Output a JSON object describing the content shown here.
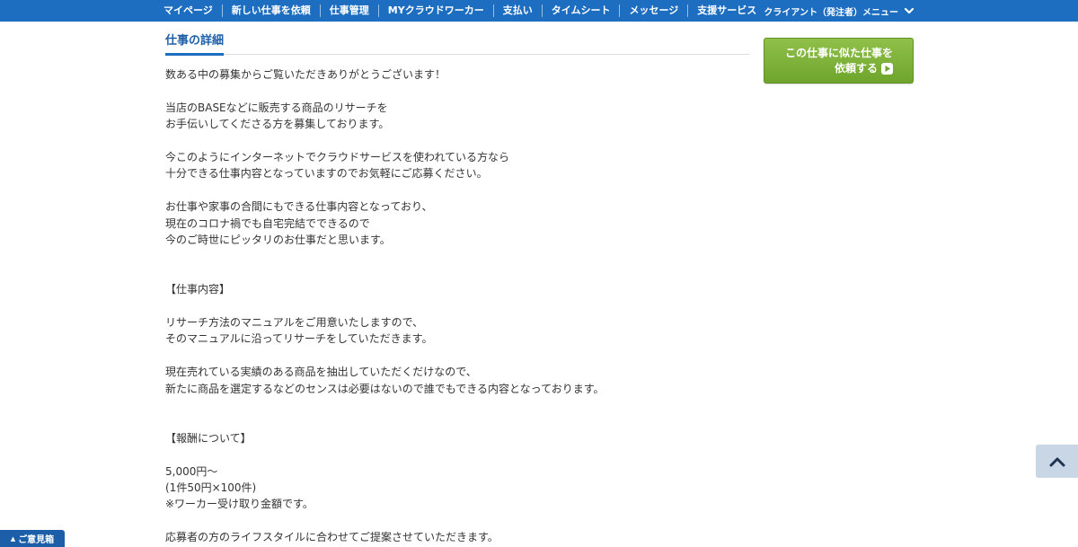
{
  "topnav": {
    "items": [
      {
        "label": "マイページ"
      },
      {
        "label": "新しい仕事を依頼"
      },
      {
        "label": "仕事管理"
      },
      {
        "label": "MYクラウドワーカー"
      },
      {
        "label": "支払い"
      },
      {
        "label": "タイムシート"
      },
      {
        "label": "メッセージ"
      },
      {
        "label": "支援サービス"
      }
    ],
    "client_menu_label": "クライアント（発注者）メニュー",
    "client_menu_icon": "chevron-down-icon"
  },
  "detail": {
    "title": "仕事の詳細",
    "lines": {
      "l1": "数ある中の募集からご覧いただきありがとうございます！",
      "l2": "当店のBASEなどに販売する商品のリサーチを",
      "l3": "お手伝いしてくださる方を募集しております。",
      "l4": "今このようにインターネットでクラウドサービスを使われている方なら",
      "l5": "十分できる仕事内容となっていますのでお気軽にご応募ください。",
      "l6": "お仕事や家事の合間にもできる仕事内容となっており、",
      "l7": "現在のコロナ禍でも自宅完結でできるので",
      "l8": "今のご時世にピッタリのお仕事だと思います。",
      "l9": "【仕事内容】",
      "l10": "リサーチ方法のマニュアルをご用意いたしますので、",
      "l11": "そのマニュアルに沿ってリサーチをしていただきます。",
      "l12": "現在売れている実績のある商品を抽出していただくだけなので、",
      "l13": "新たに商品を選定するなどのセンスは必要はないので誰でもできる内容となっております。",
      "l14": "【報酬について】",
      "l15": "5,000円〜",
      "l16": "(1件50円×100件)",
      "l17": "※ワーカー受け取り金額です。",
      "l18": "応募者の方のライフスタイルに合わせてご提案させていただきます。"
    }
  },
  "similar_button": {
    "line1": "この仕事に似た仕事を",
    "line2": "依頼する",
    "icon": "play-circle-icon"
  },
  "scroll_top_button": {
    "icon": "chevron-up-icon"
  },
  "feedback_tab": {
    "label": "ご意見箱",
    "icon": "triangle-up-icon"
  },
  "colors": {
    "nav_bg": "#1d6ec1",
    "title_blue": "#1d5ea8",
    "button_green": "#7cb23a",
    "top_button_bg": "#c8d6e5"
  }
}
